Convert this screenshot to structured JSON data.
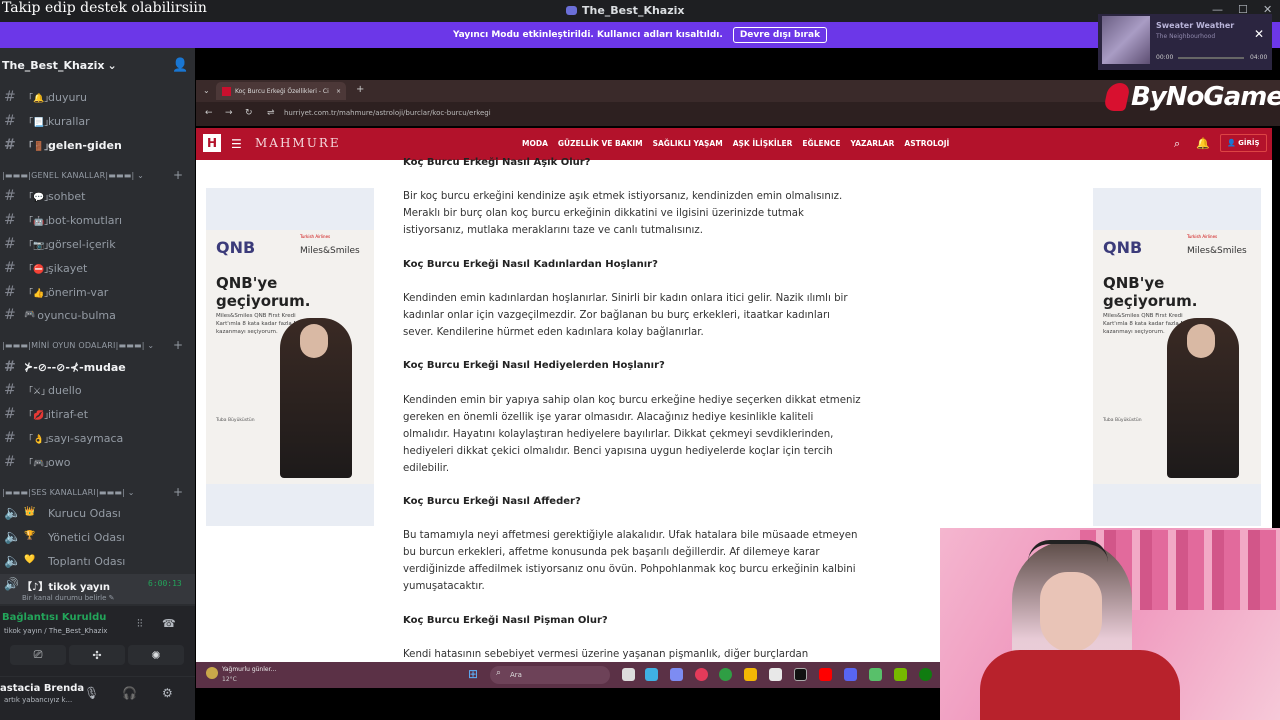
{
  "overlay_text": "Takip edip destek olabilirsiin",
  "window": {
    "title": "The_Best_Khazix",
    "minimize": "—",
    "maximize": "☐",
    "close": "✕"
  },
  "banner": {
    "text": "Yayıncı Modu etkinleştirildi. Kullanıcı adları kısaltıldı.",
    "button": "Devre dışı bırak",
    "close": "✕"
  },
  "music": {
    "song": "Sweater Weather",
    "artist": "The Neighbourhood",
    "time_current": "00:00",
    "time_total": "04:00"
  },
  "server": {
    "name": "The_Best_Khazix",
    "chevron": "⌄",
    "add_icon": "👤"
  },
  "channels_top": [
    {
      "emoji": "「🔔」",
      "name": "duyuru"
    },
    {
      "emoji": "「📃」",
      "name": "kurallar"
    },
    {
      "emoji": "「🚪」",
      "name": "gelen-giden"
    }
  ],
  "categories": {
    "general": "|▬▬▬|GENEL KANALLAR|▬▬▬|",
    "mini": "|▬▬▬|MİNİ OYUN ODALARI|▬▬▬|",
    "voice": "|▬▬▬|SES KANALLARI|▬▬▬|"
  },
  "channels_general": [
    {
      "emoji": "「💬」",
      "name": "sohbet"
    },
    {
      "emoji": "「🤖」",
      "name": "bot-komutları"
    },
    {
      "emoji": "「📷」",
      "name": "görsel-içerik"
    },
    {
      "emoji": "「⛔」",
      "name": "şikayet"
    },
    {
      "emoji": "「👍」",
      "name": "önerim-var"
    },
    {
      "emoji": "🎮",
      "name": "oyuncu-bulma"
    }
  ],
  "channels_mini": [
    {
      "emoji": "",
      "name": "⊁-⊘--⊘-⊀-mudae"
    },
    {
      "emoji": "「⚔」",
      "name": "duello"
    },
    {
      "emoji": "「💋」",
      "name": "itiraf-et"
    },
    {
      "emoji": "「👌」",
      "name": "sayı-saymaca"
    },
    {
      "emoji": "「🎮」",
      "name": "owo"
    }
  ],
  "channels_voice": [
    {
      "emoji": "👑",
      "name": "Kurucu Odası"
    },
    {
      "emoji": "🏆",
      "name": "Yönetici Odası"
    },
    {
      "emoji": "💛",
      "name": "Toplantı Odası"
    }
  ],
  "voice_active": {
    "name": "【♪】tikok yayın",
    "time": "6:00:13",
    "status": "Bir kanal durumu belirle ✎"
  },
  "connection": {
    "title": "Bağlantısı Kuruldu",
    "sub": "tikok yayın / The_Best_Khazix"
  },
  "user": {
    "name": "astacia Brenda",
    "sub": "artık yabancıyız k..."
  },
  "browser": {
    "tab_title": "Koç Burcu Erkeği Özellikleri - Ci",
    "url": "hurriyet.com.tr/mahmure/astroloji/burclar/koc-burcu/erkegi",
    "overlay_logo": "ByNoGame"
  },
  "site": {
    "logo_letter": "H",
    "logo": "MAHMURE",
    "nav": [
      "MODA",
      "GÜZELLİK VE BAKIM",
      "SAĞLIKLI YAŞAM",
      "AŞK İLİŞKİLER",
      "EĞLENCE",
      "YAZARLAR",
      "ASTROLOJİ"
    ],
    "login": "GİRİŞ"
  },
  "ad": {
    "brand": "QNB",
    "partner": "Miles&Smiles",
    "small_logo": "Turkish Airlines",
    "headline": "QNB'ye geçiyorum.",
    "sub": "Miles&Smiles QNB First Kredi Kart'ımla 8 kata kadar fazla Mil kazanmayı seçiyorum.",
    "signature": "Tuba Büyüküstün"
  },
  "article": {
    "sections": [
      {
        "title": "Koç Burcu Erkeği Nasıl Aşık Olur?",
        "text": ""
      },
      {
        "title": "",
        "text": "Bir koç burcu erkeğini kendinize aşık etmek istiyorsanız, kendinizden emin olmalısınız. Meraklı bir burç olan koç burcu erkeğinin dikkatini ve ilgisini üzerinizde tutmak istiyorsanız, mutlaka meraklarını taze ve canlı tutmalısınız."
      },
      {
        "title": "Koç Burcu Erkeği Nasıl Kadınlardan Hoşlanır?",
        "text": "Kendinden emin kadınlardan hoşlanırlar. Sinirli bir kadın onlara itici gelir. Nazik ılımlı bir kadınlar onlar için vazgeçilmezdir. Zor bağlanan bu burç erkekleri, itaatkar kadınları sever. Kendilerine hürmet eden kadınlara kolay bağlanırlar."
      },
      {
        "title": "Koç Burcu Erkeği Nasıl Hediyelerden Hoşlanır?",
        "text": "Kendinden emin bir yapıya sahip olan koç burcu erkeğine hediye seçerken dikkat etmeniz gereken en önemli özellik işe yarar olmasıdır. Alacağınız hediye kesinlikle kaliteli olmalıdır. Hayatını kolaylaştıran hediyelere bayılırlar. Dikkat çekmeyi sevdiklerinden, hediyeleri dikkat çekici olmalıdır. Benci yapısına uygun hediyelerde koçlar için tercih edilebilir."
      },
      {
        "title": "Koç Burcu Erkeği Nasıl Affeder?",
        "text": "Bu tamamıyla neyi affetmesi gerektiğiyle alakalıdır. Ufak hatalara bile müsaade etmeyen bu burcun erkekleri, affetme konusunda pek başarılı değillerdir. Af dilemeye karar verdiğinizde affedilmek istiyorsanız onu övün. Pohpohlanmak koç burcu erkeğinin kalbini yumuşatacaktır."
      },
      {
        "title": "Koç Burcu Erkeği Nasıl Pişman Olur?",
        "text": "Kendi hatasının sebebiyet vermesi üzerine yaşanan pişmanlık, diğer burçlardan"
      }
    ]
  },
  "taskbar": {
    "weather": "Yağmurlu günler...",
    "temp": "12°C",
    "search": "Ara"
  }
}
